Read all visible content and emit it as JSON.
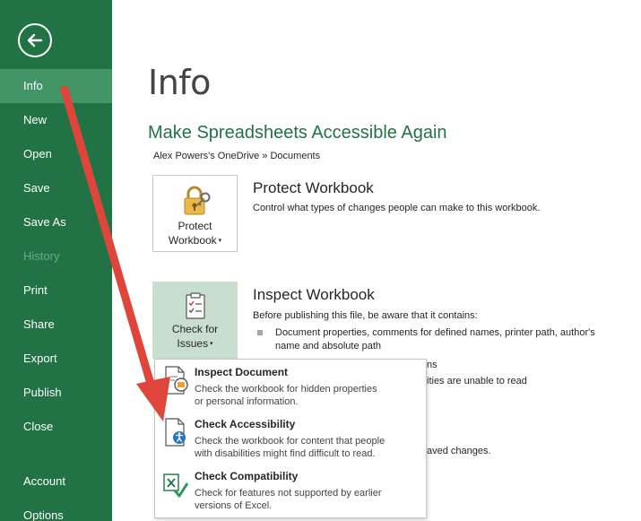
{
  "sidebar": {
    "items": [
      {
        "label": "Info"
      },
      {
        "label": "New"
      },
      {
        "label": "Open"
      },
      {
        "label": "Save"
      },
      {
        "label": "Save As"
      },
      {
        "label": "History"
      },
      {
        "label": "Print"
      },
      {
        "label": "Share"
      },
      {
        "label": "Export"
      },
      {
        "label": "Publish"
      },
      {
        "label": "Close"
      }
    ],
    "bottom_items": [
      {
        "label": "Account"
      },
      {
        "label": "Options"
      }
    ]
  },
  "main": {
    "page_title": "Info",
    "doc_title": "Make Spreadsheets Accessible Again",
    "doc_path": "Alex Powers's OneDrive » Documents",
    "protect": {
      "tile_line1": "Protect",
      "tile_line2": "Workbook",
      "title": "Protect Workbook",
      "description": "Control what types of changes people can make to this workbook."
    },
    "inspect": {
      "tile_line1": "Check for",
      "tile_line2": "Issues",
      "title": "Inspect Workbook",
      "description": "Before publishing this file, be aware that it contains:",
      "bullet1_line1": "Document properties, comments for defined names, printer path, author's",
      "bullet1_line2": "name and absolute path",
      "bullet2_partial": "ns",
      "bullet3_partial": "ities are unable to read",
      "bullet4_partial": "aved changes."
    }
  },
  "dropdown": {
    "items": [
      {
        "title": "Inspect Document",
        "desc_line1": "Check the workbook for hidden properties",
        "desc_line2": "or personal information."
      },
      {
        "title": "Check Accessibility",
        "desc_line1": "Check the workbook for content that people",
        "desc_line2": "with disabilities might find difficult to read."
      },
      {
        "title": "Check Compatibility",
        "desc_line1": "Check for features not supported by earlier",
        "desc_line2": "versions of Excel."
      }
    ]
  },
  "colors": {
    "sidebar": "#217346",
    "sidebar_active": "#439467",
    "accent": "#217346",
    "arrow": "#e0453b"
  }
}
